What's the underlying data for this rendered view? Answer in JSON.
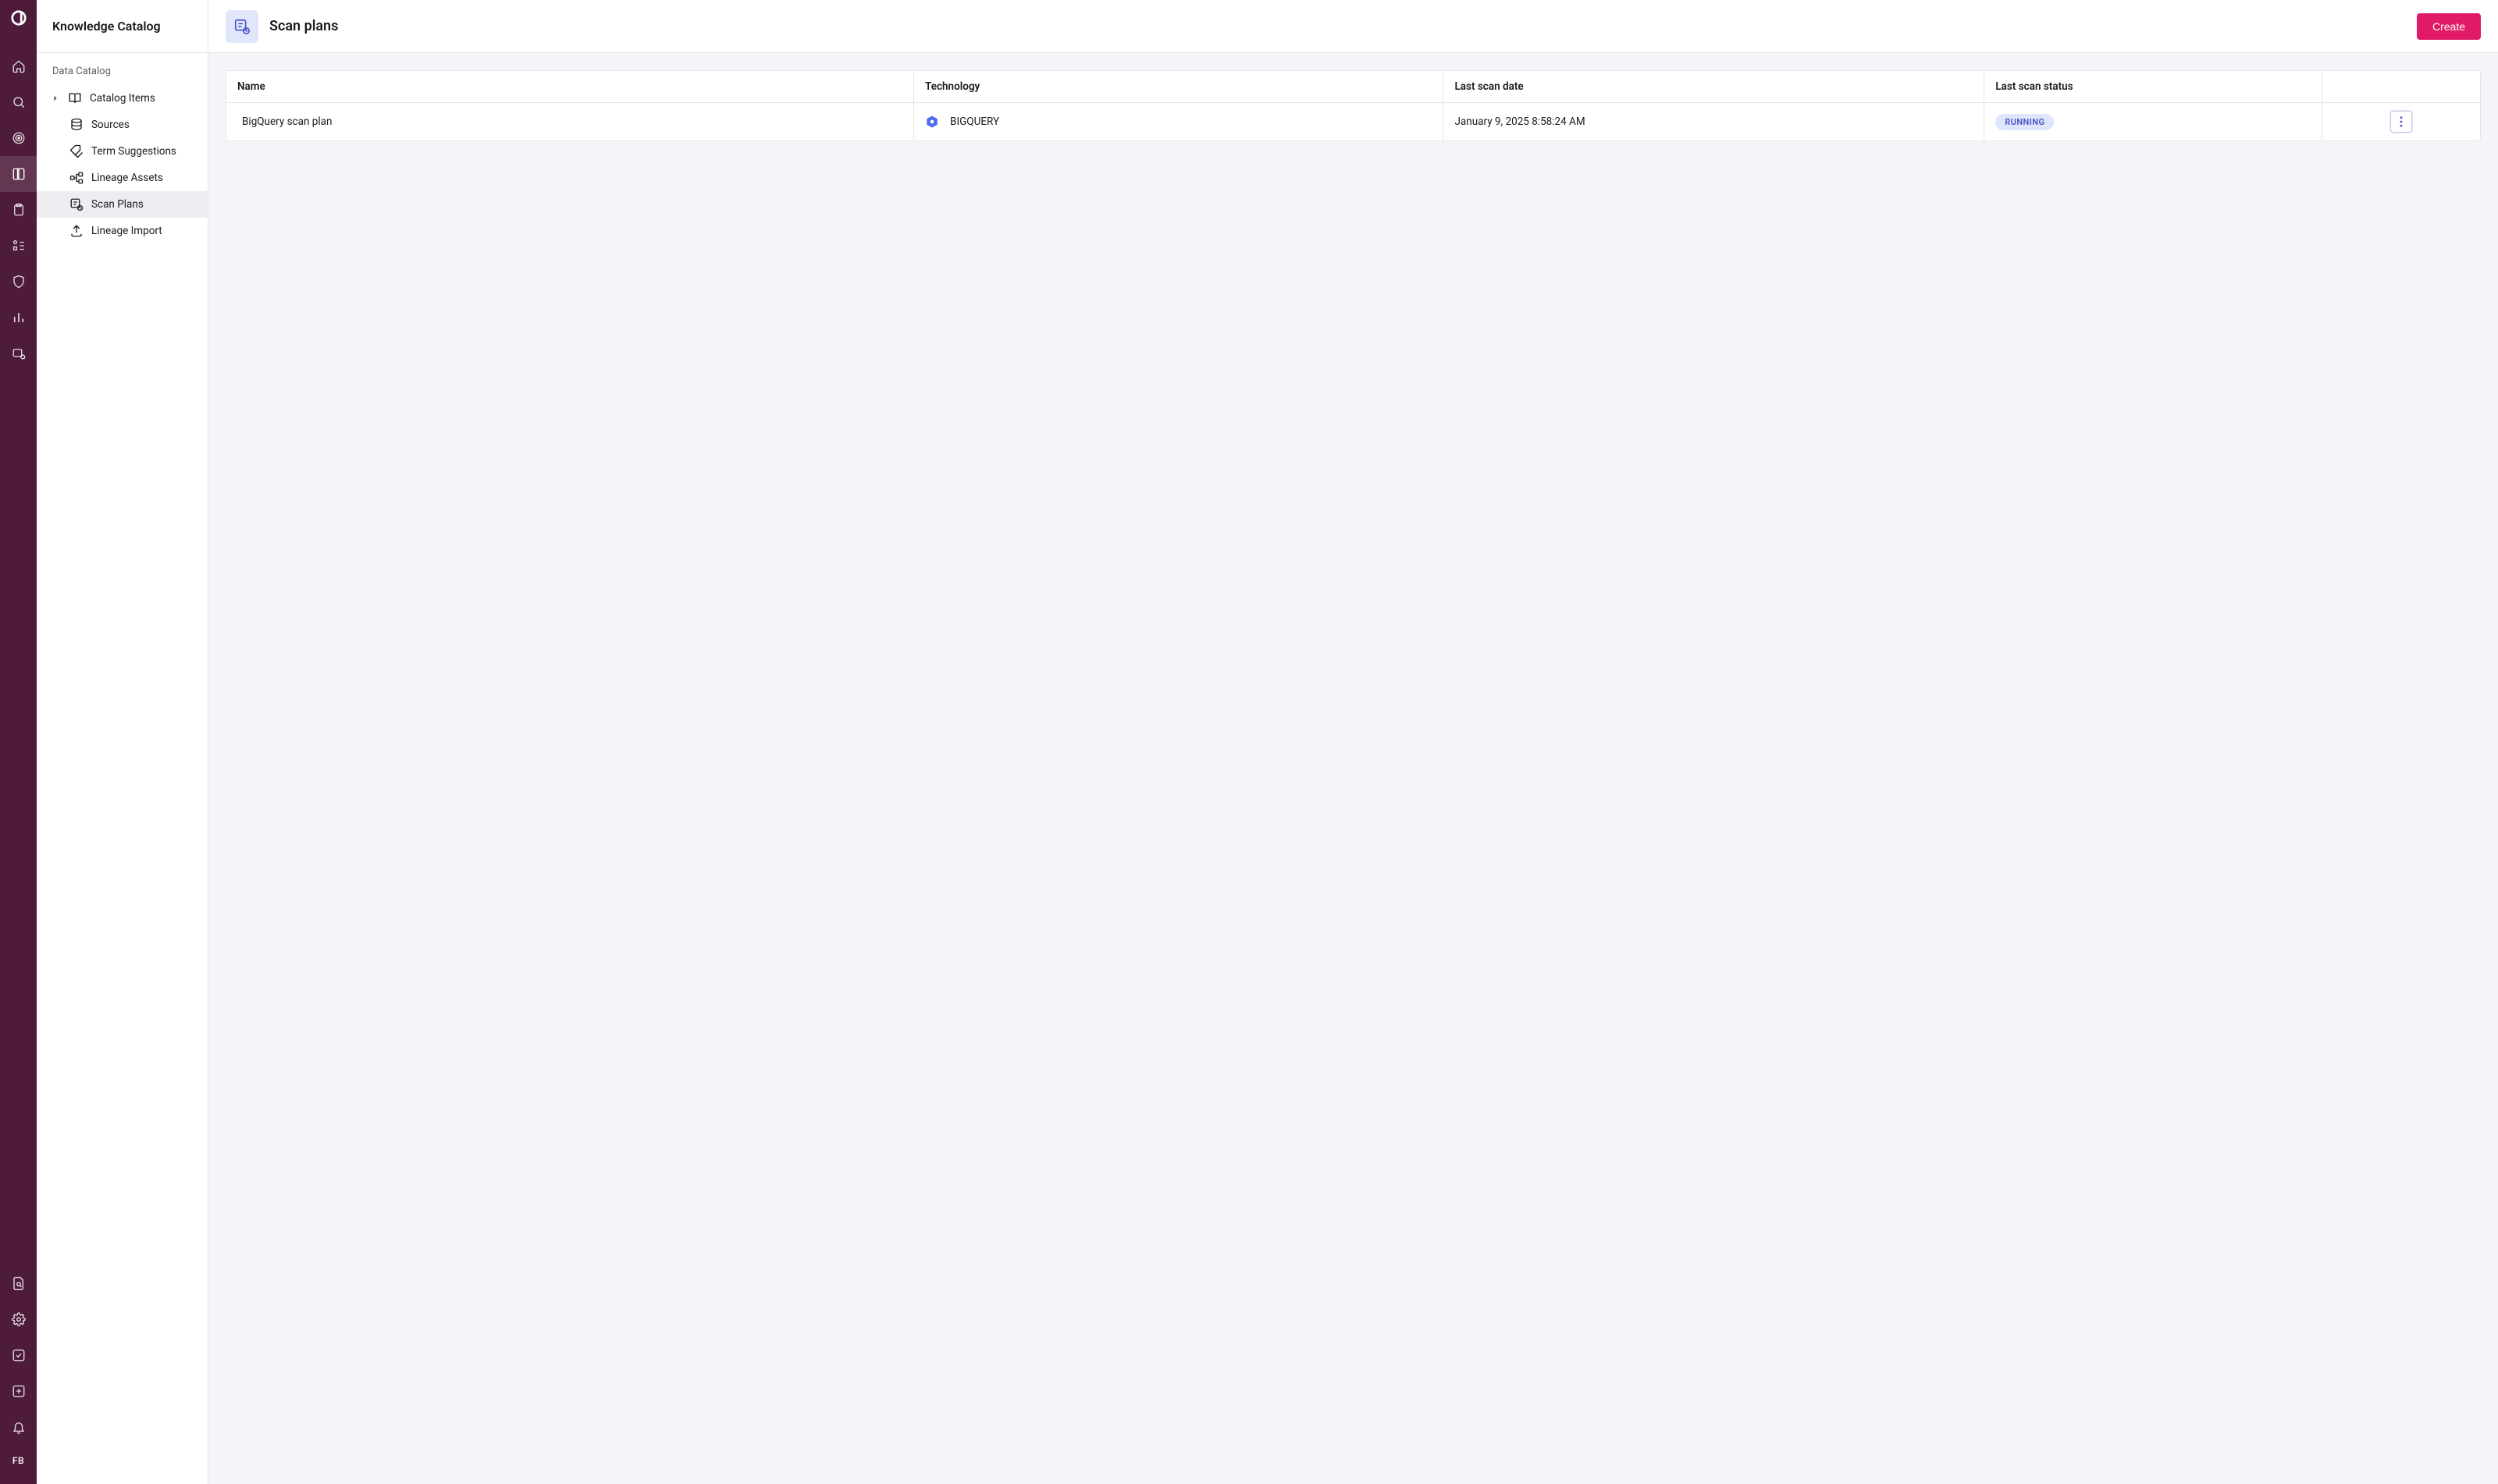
{
  "sidebar": {
    "title": "Knowledge Catalog",
    "section_label": "Data Catalog",
    "items": [
      {
        "label": "Catalog Items",
        "icon": "book-open",
        "has_children": true
      },
      {
        "label": "Sources",
        "icon": "database"
      },
      {
        "label": "Term Suggestions",
        "icon": "tag"
      },
      {
        "label": "Lineage Assets",
        "icon": "flow"
      },
      {
        "label": "Scan Plans",
        "icon": "scan",
        "active": true
      },
      {
        "label": "Lineage Import",
        "icon": "upload"
      }
    ]
  },
  "rail": {
    "avatar_initials": "FB"
  },
  "header": {
    "page_title": "Scan plans",
    "create_button": "Create"
  },
  "table": {
    "columns": {
      "name": "Name",
      "technology": "Technology",
      "last_scan_date": "Last scan date",
      "last_scan_status": "Last scan status"
    },
    "rows": [
      {
        "name": "BigQuery scan plan",
        "technology": "BIGQUERY",
        "last_scan_date": "January 9, 2025 8:58:24 AM",
        "last_scan_status": "RUNNING"
      }
    ]
  }
}
